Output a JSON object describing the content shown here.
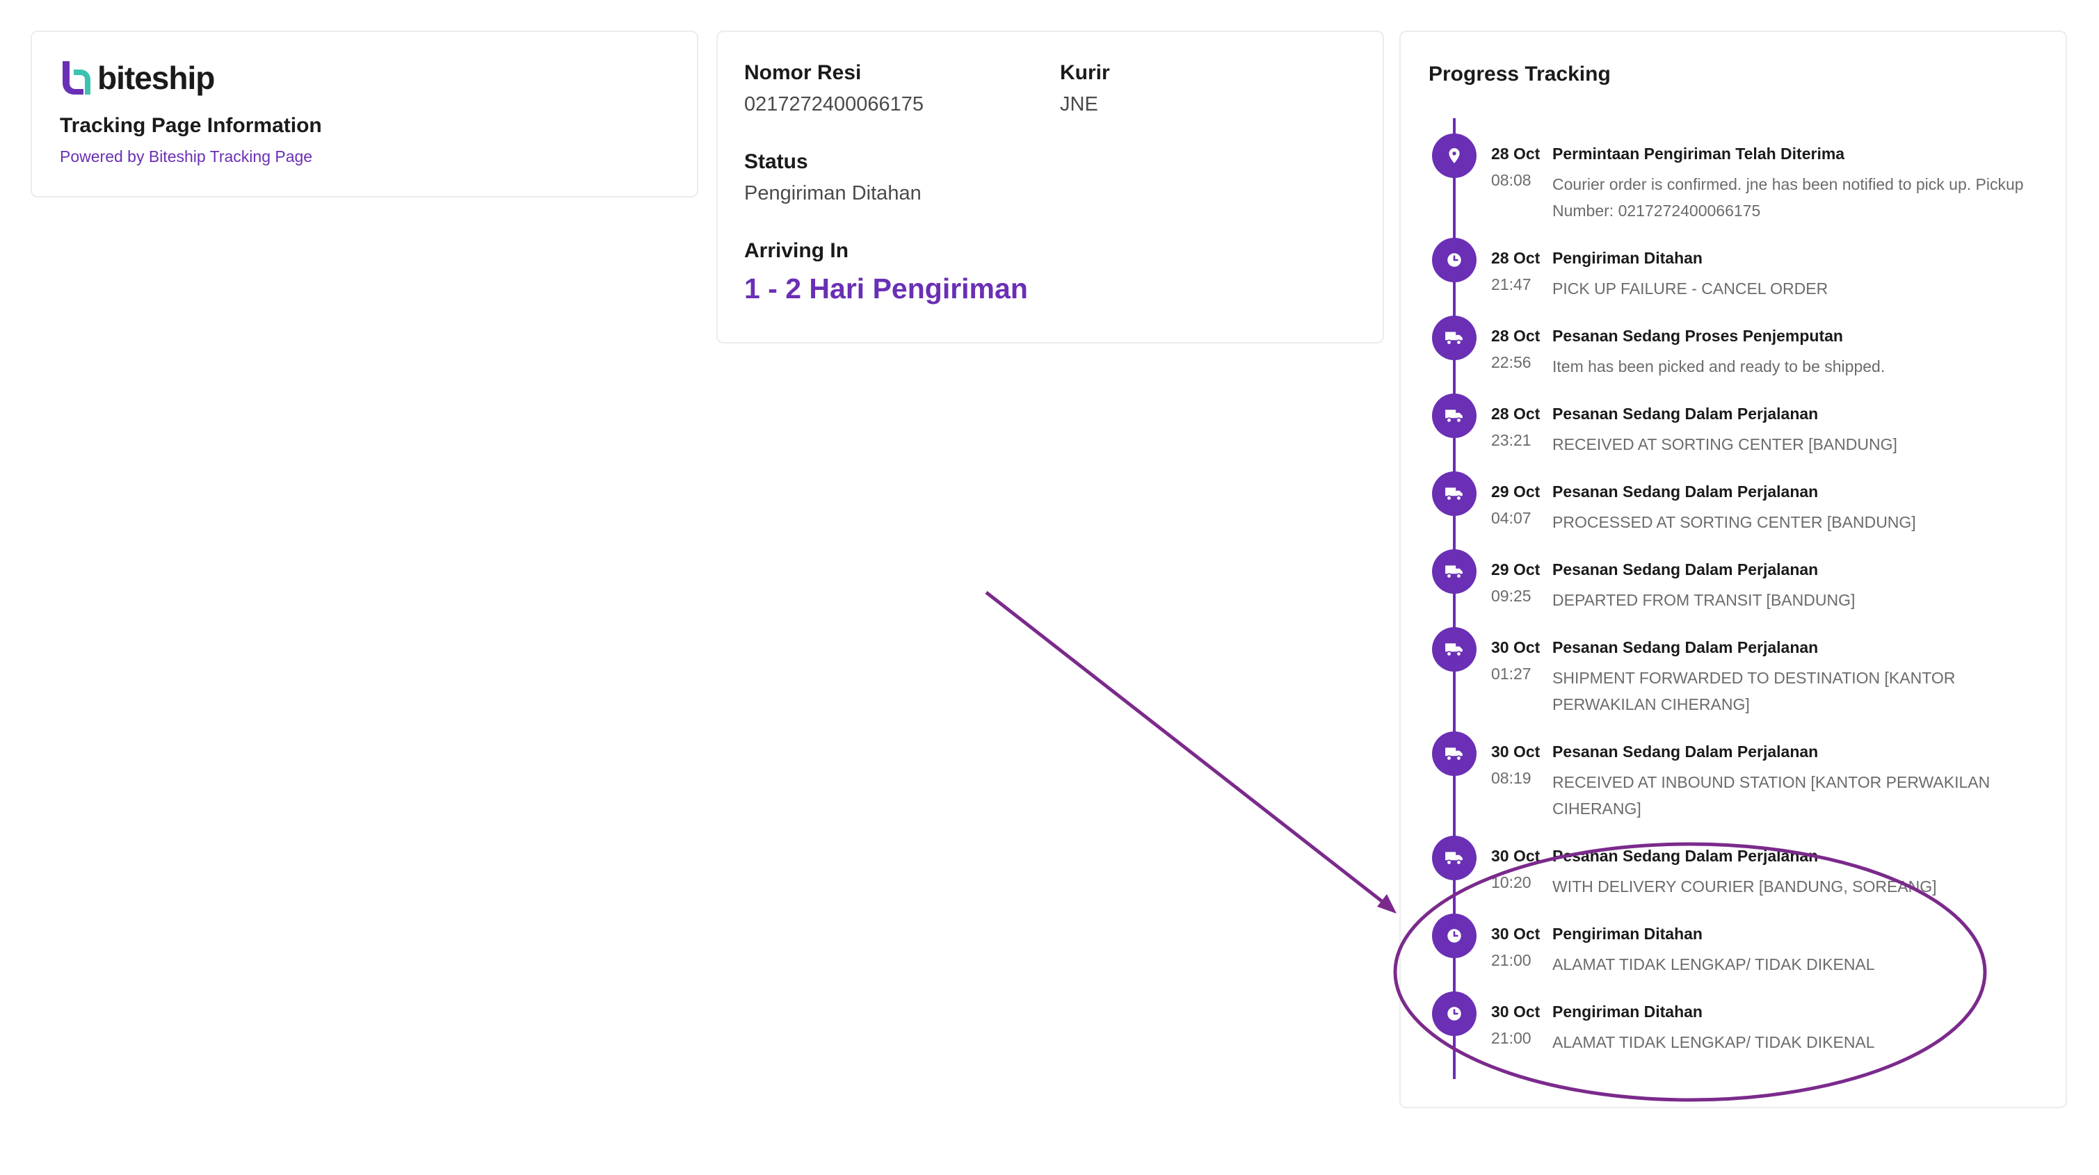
{
  "brand": {
    "name": "biteship",
    "accent": "#6a2fb5",
    "logo_teal": "#3cc3b0"
  },
  "info_card": {
    "title": "Tracking Page Information",
    "powered_by": "Powered by Biteship Tracking Page"
  },
  "detail_card": {
    "nomor_resi_label": "Nomor Resi",
    "nomor_resi_value": "0217272400066175",
    "kurir_label": "Kurir",
    "kurir_value": "JNE",
    "status_label": "Status",
    "status_value": "Pengiriman Ditahan",
    "arriving_label": "Arriving In",
    "arriving_value": "1 - 2 Hari Pengiriman"
  },
  "progress": {
    "title": "Progress Tracking",
    "events": [
      {
        "date": "28 Oct",
        "time": "08:08",
        "title": "Permintaan Pengiriman Telah Diterima",
        "desc": "Courier order is confirmed. jne has been notified to pick up. Pickup Number: 0217272400066175",
        "icon": "location-pin-icon"
      },
      {
        "date": "28 Oct",
        "time": "21:47",
        "title": "Pengiriman Ditahan",
        "desc": "PICK UP FAILURE - CANCEL ORDER",
        "icon": "clock-icon"
      },
      {
        "date": "28 Oct",
        "time": "22:56",
        "title": "Pesanan Sedang Proses Penjemputan",
        "desc": "Item has been picked and ready to be shipped.",
        "icon": "truck-icon"
      },
      {
        "date": "28 Oct",
        "time": "23:21",
        "title": "Pesanan Sedang Dalam Perjalanan",
        "desc": "RECEIVED AT SORTING CENTER [BANDUNG]",
        "icon": "truck-icon"
      },
      {
        "date": "29 Oct",
        "time": "04:07",
        "title": "Pesanan Sedang Dalam Perjalanan",
        "desc": "PROCESSED AT SORTING CENTER [BANDUNG]",
        "icon": "truck-icon"
      },
      {
        "date": "29 Oct",
        "time": "09:25",
        "title": "Pesanan Sedang Dalam Perjalanan",
        "desc": "DEPARTED FROM TRANSIT [BANDUNG]",
        "icon": "truck-icon"
      },
      {
        "date": "30 Oct",
        "time": "01:27",
        "title": "Pesanan Sedang Dalam Perjalanan",
        "desc": "SHIPMENT FORWARDED TO DESTINATION [KANTOR PERWAKILAN CIHERANG]",
        "icon": "truck-icon"
      },
      {
        "date": "30 Oct",
        "time": "08:19",
        "title": "Pesanan Sedang Dalam Perjalanan",
        "desc": "RECEIVED AT INBOUND STATION [KANTOR PERWAKILAN CIHERANG]",
        "icon": "truck-icon"
      },
      {
        "date": "30 Oct",
        "time": "10:20",
        "title": "Pesanan Sedang Dalam Perjalanan",
        "desc": "WITH DELIVERY COURIER [BANDUNG, SOREANG]",
        "icon": "truck-icon"
      },
      {
        "date": "30 Oct",
        "time": "21:00",
        "title": "Pengiriman Ditahan",
        "desc": "ALAMAT TIDAK LENGKAP/ TIDAK DIKENAL",
        "icon": "clock-icon"
      },
      {
        "date": "30 Oct",
        "time": "21:00",
        "title": "Pengiriman Ditahan",
        "desc": "ALAMAT TIDAK LENGKAP/ TIDAK DIKENAL",
        "icon": "clock-icon"
      }
    ]
  },
  "annotation": {
    "color": "#7b2a8c"
  }
}
